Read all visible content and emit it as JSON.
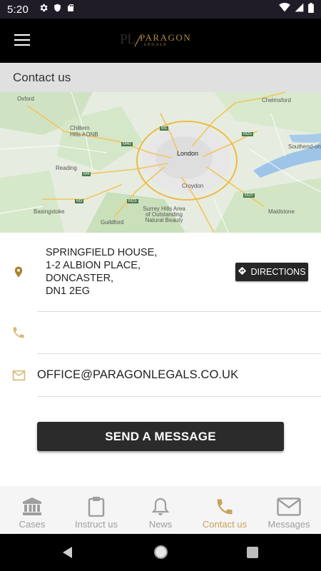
{
  "status_bar": {
    "time": "5:20",
    "icons_left": [
      "gear-icon",
      "shield-icon",
      "sd-card-icon"
    ],
    "icons_right": [
      "wifi-icon",
      "signal-icon",
      "battery-icon"
    ]
  },
  "app_bar": {
    "logo_mark": "PL",
    "logo_name": "PARAGON",
    "logo_sub": "LEGALS"
  },
  "page": {
    "title": "Contact us"
  },
  "map": {
    "labels": [
      {
        "name": "oxford",
        "text": "Oxford"
      },
      {
        "name": "chelmsford",
        "text": "Chelmsford"
      },
      {
        "name": "chiltern-hills",
        "text": "Chiltern Hills AONB"
      },
      {
        "name": "london",
        "text": "London"
      },
      {
        "name": "southend",
        "text": "Southend-on-Sea"
      },
      {
        "name": "reading",
        "text": "Reading"
      },
      {
        "name": "croydon",
        "text": "Croydon"
      },
      {
        "name": "basingstoke",
        "text": "Basingstoke"
      },
      {
        "name": "guildford",
        "text": "Guildford"
      },
      {
        "name": "surrey-hills",
        "text": "Surrey Hills Area of Outstanding Natural Beauty"
      },
      {
        "name": "maidstone",
        "text": "Maidstone"
      },
      {
        "name": "m1",
        "text": "M1"
      },
      {
        "name": "m40",
        "text": "M40"
      },
      {
        "name": "m25-north",
        "text": "M25"
      },
      {
        "name": "m25-south",
        "text": "M25"
      },
      {
        "name": "m4",
        "text": "M4"
      },
      {
        "name": "m20",
        "text": "M20"
      },
      {
        "name": "m3",
        "text": "M3"
      }
    ]
  },
  "contact": {
    "address_lines": [
      "SPRINGFIELD HOUSE,",
      "1-2 ALBION PLACE,",
      "DONCASTER,",
      "DN1 2EG"
    ],
    "directions_label": "DIRECTIONS",
    "phone": "",
    "email": "OFFICE@PARAGONLEGALS.CO.UK",
    "send_label": "SEND A MESSAGE"
  },
  "bottom_nav": {
    "items": [
      {
        "label": "Cases",
        "icon": "bank-icon",
        "active": false
      },
      {
        "label": "Instruct us",
        "icon": "clipboard-icon",
        "active": false
      },
      {
        "label": "News",
        "icon": "bell-icon",
        "active": false
      },
      {
        "label": "Contact us",
        "icon": "phone-icon",
        "active": true
      },
      {
        "label": "Messages",
        "icon": "envelope-icon",
        "active": false
      }
    ]
  },
  "colors": {
    "accent": "#b08a3e",
    "active_nav": "#c7a35a",
    "button_bg": "#2b2b2b",
    "status_bar_bg": "#1f1c27",
    "header_bg": "#e0e0e0"
  }
}
